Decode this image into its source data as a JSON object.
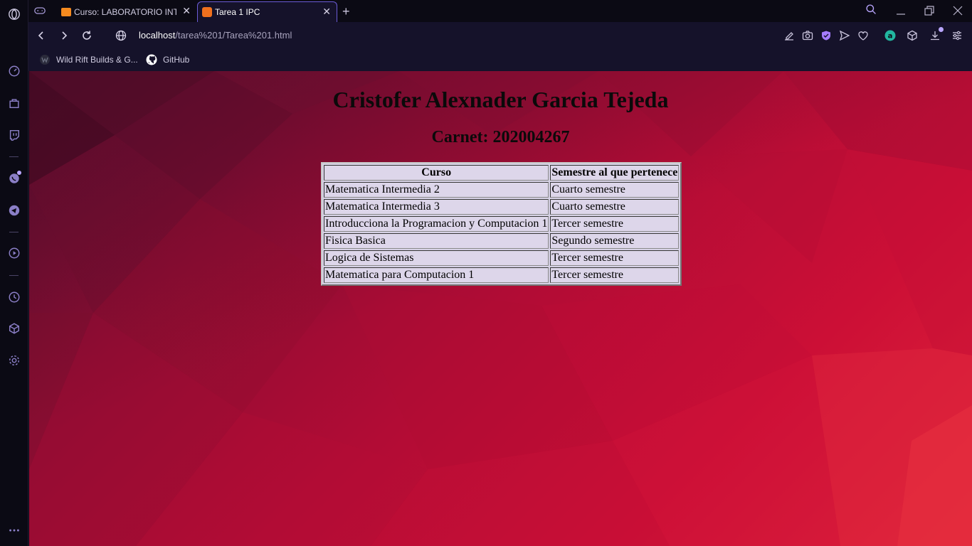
{
  "browser": {
    "tabs": [
      {
        "title": "Curso: LABORATORIO INTR",
        "active": false,
        "favicon_color": "#f58a1f"
      },
      {
        "title": "Tarea 1 IPC",
        "active": true,
        "favicon_color": "#f0701e"
      }
    ],
    "new_tab_label": "+",
    "url_host": "localhost",
    "url_path": "/tarea%201/Tarea%201.html",
    "bookmarks": [
      {
        "label": "Wild Rift Builds & G...",
        "icon": "wild-rift-icon"
      },
      {
        "label": "GitHub",
        "icon": "github-icon"
      }
    ],
    "sidebar_icons": [
      "speed-dial-icon",
      "shopping-bag-icon",
      "twitch-icon",
      "whatsapp-icon",
      "telegram-icon",
      "player-icon",
      "history-icon",
      "extensions-icon",
      "settings-icon",
      "more-icon"
    ],
    "accent_color": "#8b7fc7"
  },
  "page": {
    "heading": "Cristofer Alexnader Garcia Tejeda",
    "subheading": "Carnet: 202004267",
    "table": {
      "headers": [
        "Curso",
        "Semestre al que pertenece"
      ],
      "rows": [
        [
          "Matematica Intermedia 2",
          "Cuarto semestre"
        ],
        [
          "Matematica Intermedia 3",
          "Cuarto semestre"
        ],
        [
          "Introducciona la Programacion y Computacion 1",
          "Tercer semestre"
        ],
        [
          "Fisica Basica",
          "Segundo semestre"
        ],
        [
          "Logica de Sistemas",
          "Tercer semestre"
        ],
        [
          "Matematica para Computacion 1",
          "Tercer semestre"
        ]
      ]
    },
    "background_colors": [
      "#5c0f2e",
      "#b10c35",
      "#e0243a"
    ]
  }
}
